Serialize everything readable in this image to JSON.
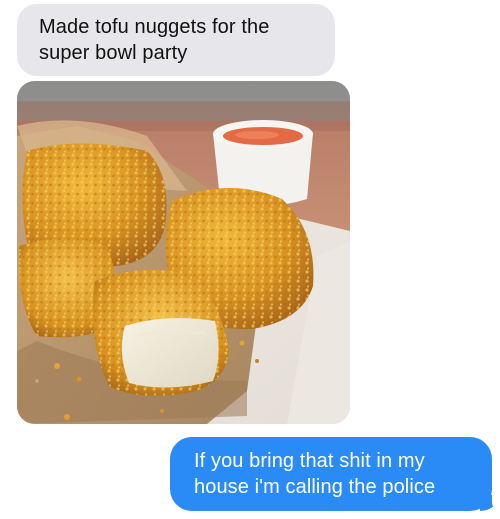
{
  "conversation": {
    "messages": [
      {
        "sender": "incoming",
        "text": "Made tofu nuggets for the super bowl party"
      },
      {
        "sender": "incoming",
        "image": "photo of breaded tofu nuggets on parchment with a cup of dipping sauce"
      },
      {
        "sender": "outgoing",
        "text": "If you bring that shit in my house i'm calling the police"
      }
    ]
  },
  "colors": {
    "incoming_bubble": "#e6e6eb",
    "outgoing_bubble": "#2b8bf6",
    "outgoing_text": "#ffffff",
    "incoming_text": "#111111"
  }
}
